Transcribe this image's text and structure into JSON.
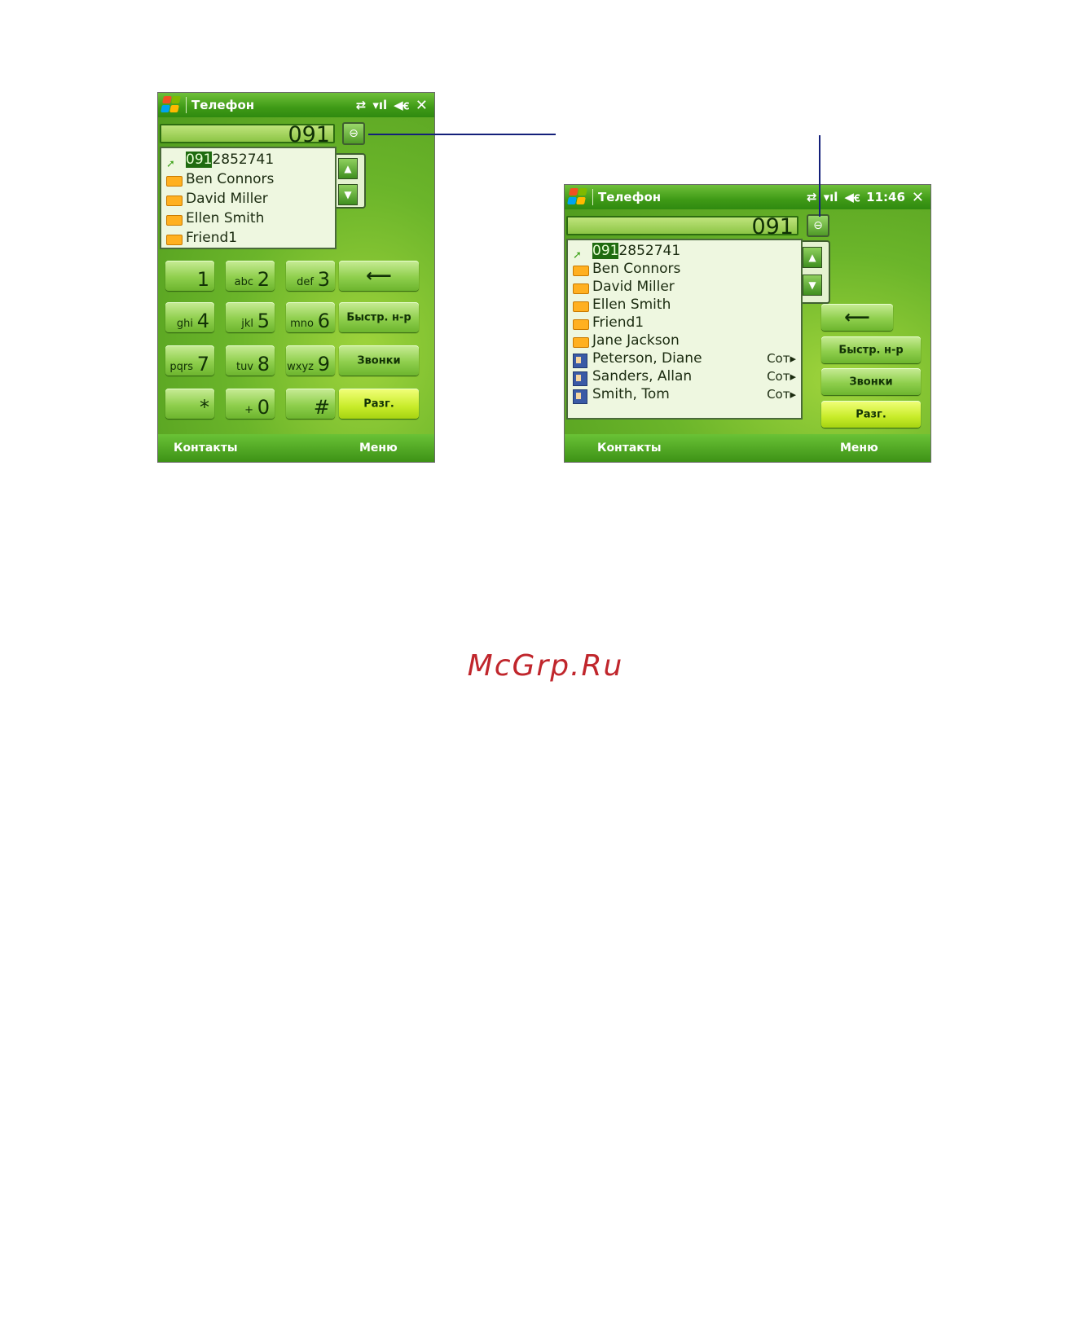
{
  "left_screen": {
    "title": "Телефон",
    "status_icons": [
      "sync-icon",
      "signal-icon",
      "speaker-icon"
    ],
    "dialed": "091",
    "list": [
      {
        "icon": "call-history-icon",
        "match": "091",
        "rest": "2852741",
        "tag": ""
      },
      {
        "icon": "sim-contact-icon",
        "match": "",
        "rest": "Ben Connors",
        "tag": ""
      },
      {
        "icon": "sim-contact-icon",
        "match": "",
        "rest": "David Miller",
        "tag": ""
      },
      {
        "icon": "sim-contact-icon",
        "match": "",
        "rest": "Ellen Smith",
        "tag": ""
      },
      {
        "icon": "sim-contact-icon",
        "match": "",
        "rest": "Friend1",
        "tag": ""
      }
    ],
    "keypad": [
      {
        "digit": "1",
        "letters": ""
      },
      {
        "digit": "2",
        "letters": "abc"
      },
      {
        "digit": "3",
        "letters": "def"
      },
      {
        "digit": "4",
        "letters": "ghi"
      },
      {
        "digit": "5",
        "letters": "jkl"
      },
      {
        "digit": "6",
        "letters": "mno"
      },
      {
        "digit": "7",
        "letters": "pqrs"
      },
      {
        "digit": "8",
        "letters": "tuv"
      },
      {
        "digit": "9",
        "letters": "wxyz"
      },
      {
        "digit": "*",
        "letters": ""
      },
      {
        "digit": "0",
        "letters": "+"
      },
      {
        "digit": "#",
        "letters": ""
      }
    ],
    "buttons": {
      "backspace": "⟵",
      "speed_dial": "Быстр. н-р",
      "calls": "Звонки",
      "talk": "Разг."
    },
    "softkeys": {
      "left": "Контакты",
      "right": "Меню"
    }
  },
  "right_screen": {
    "title": "Телефон",
    "time": "11:46",
    "dialed": "091",
    "list": [
      {
        "icon": "call-history-icon",
        "match": "091",
        "rest": "2852741",
        "tag": ""
      },
      {
        "icon": "sim-contact-icon",
        "match": "",
        "rest": "Ben Connors",
        "tag": ""
      },
      {
        "icon": "sim-contact-icon",
        "match": "",
        "rest": "David Miller",
        "tag": ""
      },
      {
        "icon": "sim-contact-icon",
        "match": "",
        "rest": "Ellen Smith",
        "tag": ""
      },
      {
        "icon": "sim-contact-icon",
        "match": "",
        "rest": "Friend1",
        "tag": ""
      },
      {
        "icon": "sim-contact-icon",
        "match": "",
        "rest": "Jane Jackson",
        "tag": ""
      },
      {
        "icon": "outlook-contact-icon",
        "match": "",
        "rest": "Peterson, Diane",
        "tag": "Сот"
      },
      {
        "icon": "outlook-contact-icon",
        "match": "",
        "rest": "Sanders, Allan",
        "tag": "Сот"
      },
      {
        "icon": "outlook-contact-icon",
        "match": "",
        "rest": "Smith, Tom",
        "tag": "Сот"
      }
    ],
    "buttons": {
      "backspace": "⟵",
      "speed_dial": "Быстр. н-р",
      "calls": "Звонки",
      "talk": "Разг."
    },
    "softkeys": {
      "left": "Контакты",
      "right": "Меню"
    }
  },
  "watermark": "McGrp.Ru",
  "colors": {
    "accent_green": "#4e9a1d",
    "callout": "#14207a",
    "watermark": "#c0262c"
  }
}
